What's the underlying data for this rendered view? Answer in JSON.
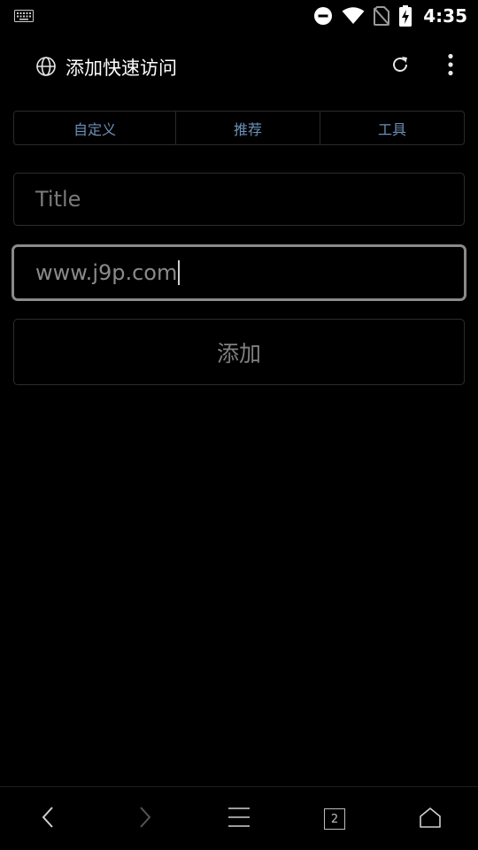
{
  "status_bar": {
    "time": "4:35",
    "icons": [
      "keyboard-icon",
      "do-not-disturb-icon",
      "wifi-icon",
      "no-sim-icon",
      "battery-charging-icon"
    ]
  },
  "header": {
    "title": "添加快速访问",
    "icons": [
      "globe-icon",
      "refresh-icon",
      "more-vert-icon"
    ]
  },
  "tabs": [
    {
      "label": "自定义"
    },
    {
      "label": "推荐"
    },
    {
      "label": "工具"
    }
  ],
  "form": {
    "title_placeholder": "Title",
    "url_value": "www.j9p.com",
    "add_label": "添加"
  },
  "bottom_nav": {
    "tab_count": "2",
    "icons": [
      "back-icon",
      "forward-icon",
      "menu-icon",
      "tabs-icon",
      "home-icon"
    ]
  },
  "colors": {
    "background": "#000000",
    "tab_text": "#6d8fb8",
    "border": "#2c2c2c",
    "focused_border": "#8a8a8a"
  }
}
